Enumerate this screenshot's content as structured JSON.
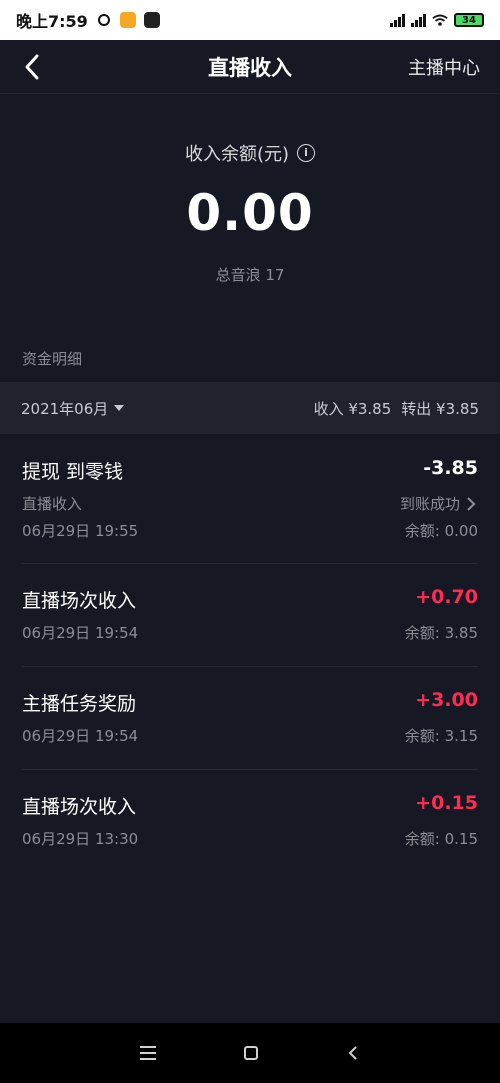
{
  "status_bar": {
    "time": "晚上7:59",
    "battery": "34"
  },
  "nav": {
    "title": "直播收入",
    "action": "主播中心"
  },
  "balance": {
    "label": "收入余额(元)",
    "info_icon": "i",
    "value": "0.00",
    "total_sound": "总音浪 17"
  },
  "details": {
    "title": "资金明细",
    "month": "2021年06月",
    "income": "收入 ¥3.85",
    "outgo": "转出 ¥3.85"
  },
  "transactions": [
    {
      "title": "提现 到零钱",
      "amount": "-3.85",
      "source": "直播收入",
      "status": "到账成功",
      "time": "06月29日 19:55",
      "balance": "余额: 0.00"
    },
    {
      "title": "直播场次收入",
      "amount": "+0.70",
      "time": "06月29日 19:54",
      "balance": "余额: 3.85"
    },
    {
      "title": "主播任务奖励",
      "amount": "+3.00",
      "time": "06月29日 19:54",
      "balance": "余额: 3.15"
    },
    {
      "title": "直播场次收入",
      "amount": "+0.15",
      "time": "06月29日 13:30",
      "balance": "余额: 0.15"
    }
  ],
  "colors": {
    "background": "#161823",
    "positive": "#fe2c55",
    "muted": "#8c8d95"
  },
  "icons": [
    "back-icon",
    "info-icon",
    "caret-down-icon",
    "chevron-right-icon",
    "menu-icon",
    "home-icon",
    "back-nav-icon"
  ]
}
